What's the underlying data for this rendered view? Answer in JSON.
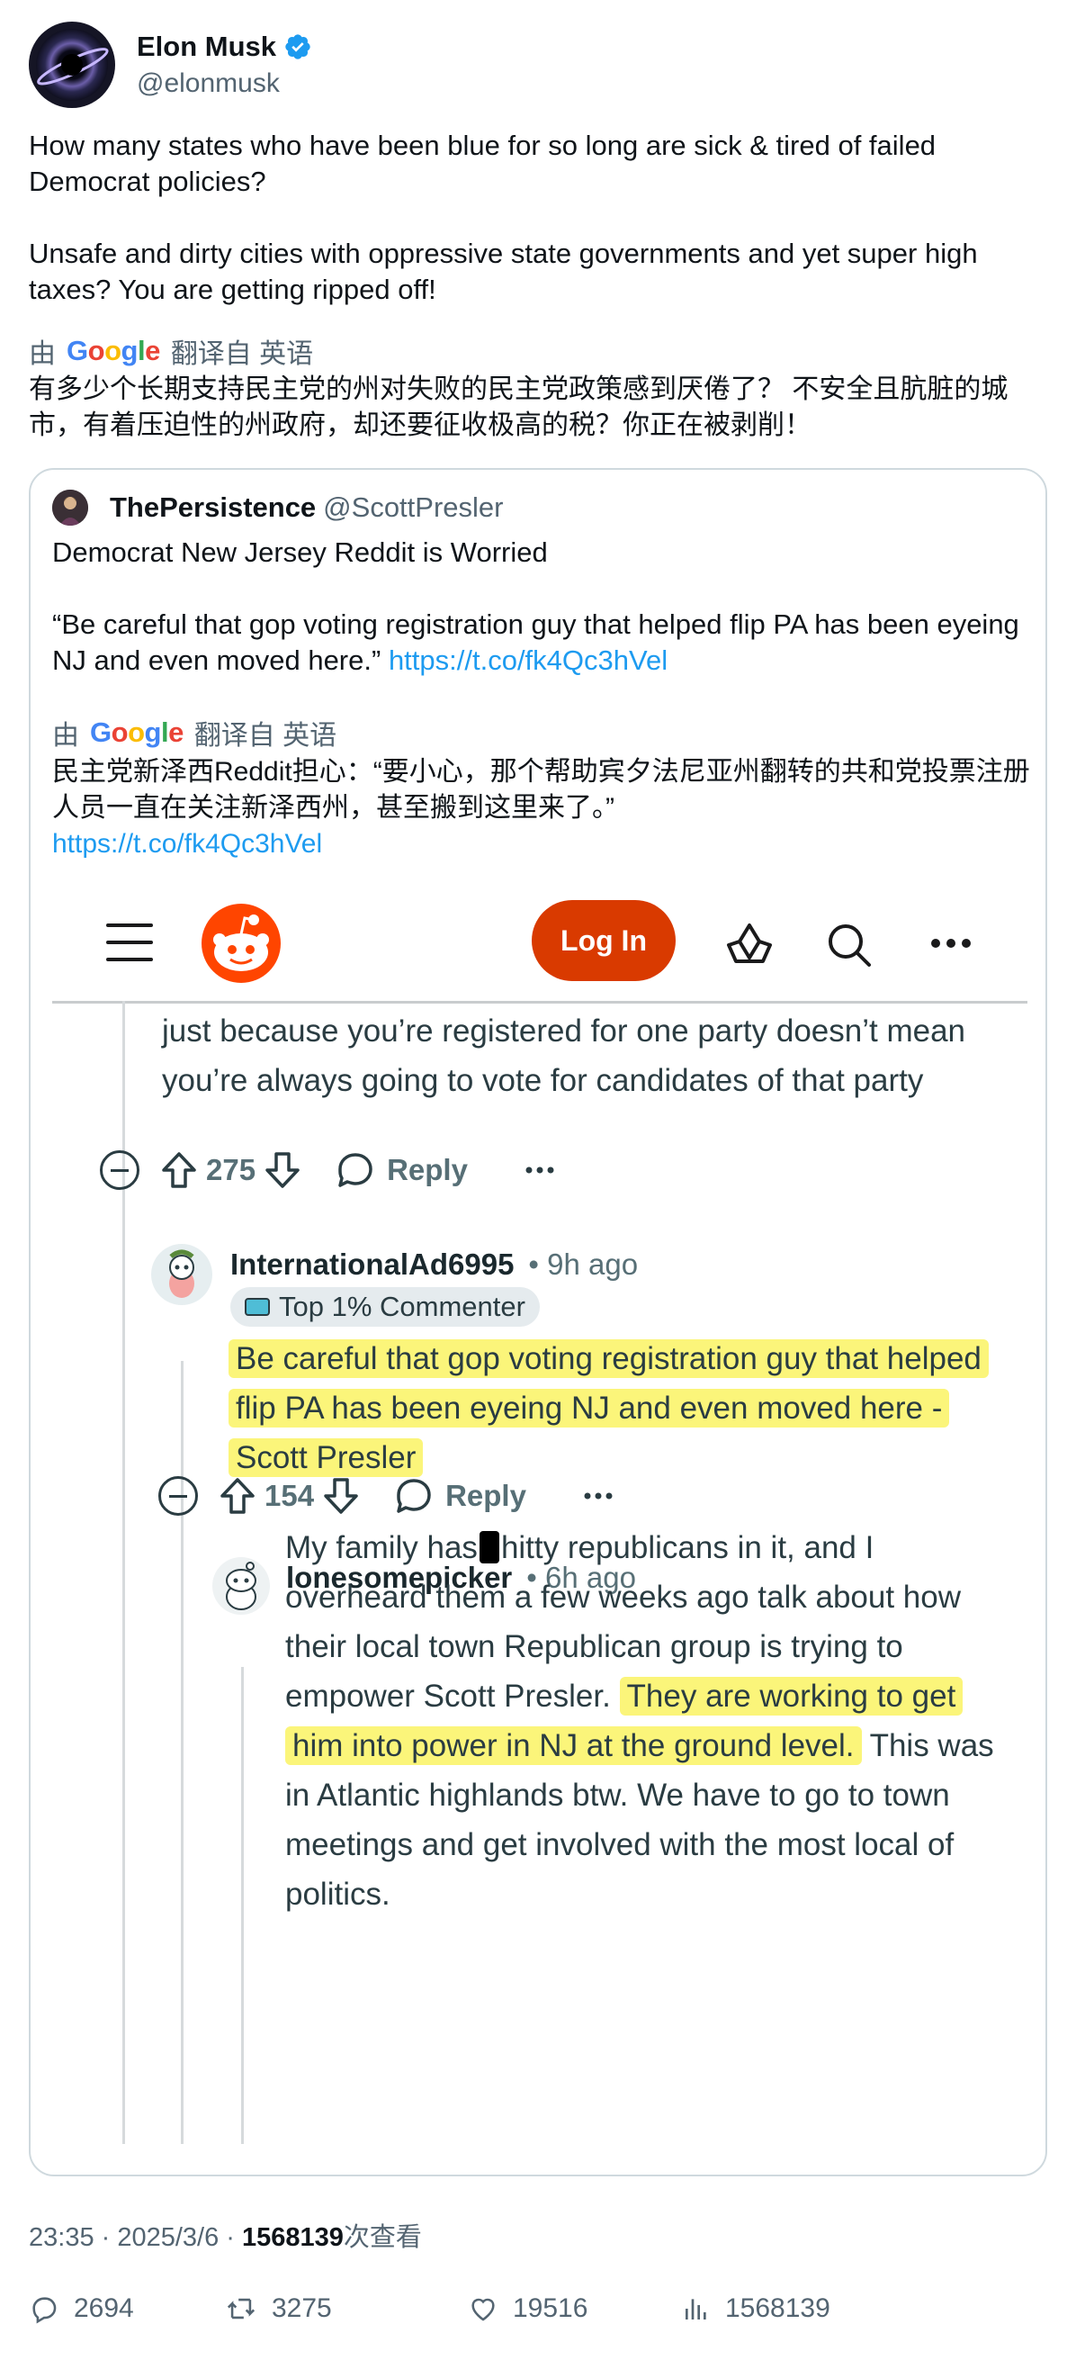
{
  "author": {
    "display_name": "Elon Musk",
    "handle": "@elonmusk",
    "verified": true,
    "verified_color": "#1d9bf0"
  },
  "post": {
    "paragraph1": "How many states who have been blue for so long are sick & tired of failed Democrat policies?",
    "paragraph2": "Unsafe and dirty cities with oppressive state governments and yet super high taxes? You are getting ripped off!",
    "translate_prefix": "由",
    "translate_suffix": "翻译自 英语",
    "translation": "有多少个长期支持民主党的州对失败的民主党政策感到厌倦了？ 不安全且肮脏的城市，有着压迫性的州政府，却还要征收极高的税？你正在被剥削！"
  },
  "quote": {
    "display_name": "ThePersistence",
    "handle": "@ScottPresler",
    "paragraph1": "Democrat New Jersey Reddit is Worried",
    "paragraph2": "“Be careful that gop voting registration guy that helped flip PA has been eyeing NJ and even moved here.”",
    "link": "https://t.co/fk4Qc3hVel",
    "translate_prefix": "由",
    "translate_suffix": "翻译自 英语",
    "translation": "民主党新泽西Reddit担心：“要小心，那个帮助宾夕法尼亚州翻转的共和党投票注册人员一直在关注新泽西州，甚至搬到这里来了。”",
    "translation_link": "https://t.co/fk4Qc3hVel"
  },
  "reddit": {
    "login_label": "Log In",
    "brand_color": "#ff4500",
    "intro_text": "just because you’re registered for one party doesn’t mean you’re always going to vote for candidates of that party",
    "comment1_votes": "275",
    "reply_label": "Reply",
    "comment2": {
      "user": "InternationalAd6995",
      "time": "• 9h ago",
      "badge": "Top 1% Commenter",
      "text": "Be careful that gop voting registration guy that helped flip PA has been eyeing NJ and even moved here - Scott Presler",
      "votes": "154"
    },
    "comment3": {
      "user": "lonesomepicker",
      "time": "• 6h ago",
      "text_a": "My family has",
      "text_b": "hitty republicans in it, and I overheard them a few weeks ago talk about how their local town Republican group is trying to empower Scott Presler.",
      "text_highlight": "They are working to get him into power in NJ at the ground level.",
      "text_c": " This was in Atlantic highlands btw. We have to go to town meetings and get involved with the most local of politics."
    },
    "highlight_color": "#fbf57a"
  },
  "meta": {
    "time": "23:35 · 2025/3/6 · ",
    "views": "1568139",
    "views_suffix": "次查看"
  },
  "stats": {
    "replies": "2694",
    "reposts": "3275",
    "likes": "19516",
    "views": "1568139"
  }
}
